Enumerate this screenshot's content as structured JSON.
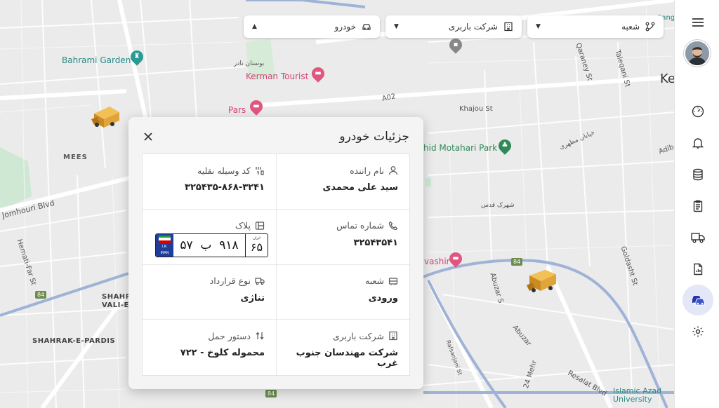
{
  "map": {
    "labels": {
      "bahrami_garden": "Bahrami Garden",
      "kerman_tourist": "Kerman Tourist",
      "pars": "Pars",
      "mees": "MEES",
      "jomhouri": "Jomhouri Blvd",
      "hemati": "Hemati-Far St",
      "shahr_vali": "SHAHR-E-\nVALI-E-",
      "shahrak_pardis": "SHAHRAK-E-PARDIS",
      "a02": "A02",
      "khajou": "Khajou St",
      "motahari_park": "hid Motahari Park",
      "qaraney": "Qaraney St",
      "taleqani": "Taleqani St",
      "kerman_top": "Ke",
      "adib": "Adib",
      "vashir": "vashir",
      "goldasht": "Goldasht St",
      "abuzar_s": "Abuzar S",
      "abuzar": "Abuzar",
      "resalat": "Resalat Blvd",
      "azad": "Islamic Azad\nUniversity",
      "24_mehr": "24 Mehr",
      "jangal": "Sang",
      "persian_park": "بوستان نادر",
      "persian_shahrak": "شهرک قدس",
      "persian_haji": "خیابان مطهری",
      "rafsanjani": "Rafsanjani St"
    },
    "route_badges": [
      "84",
      "84",
      "84"
    ]
  },
  "filters": {
    "branch": "شعبه",
    "carrier": "شرکت باربری",
    "vehicle": "خودرو"
  },
  "sidebar": {
    "items": [
      {
        "name": "menu-icon"
      },
      {
        "name": "dashboard-icon"
      },
      {
        "name": "bell-icon"
      },
      {
        "name": "database-icon"
      },
      {
        "name": "clipboard-icon"
      },
      {
        "name": "truck-icon"
      },
      {
        "name": "report-icon"
      },
      {
        "name": "cars-icon"
      },
      {
        "name": "settings-icon"
      }
    ],
    "active": "cars-icon"
  },
  "modal": {
    "title": "جزئیات خودرو",
    "fields": {
      "driver_label": "نام راننده",
      "driver_value": "سید علی محمدی",
      "vehicle_code_label": "کد وسیله نقلیه",
      "vehicle_code_value": "۳۲۵۴۳۵-۸۶۸-۳۲۴۱",
      "phone_label": "شماره تماس",
      "phone_value": "۳۲۵۴۳۵۴۱",
      "plate_label": "پلاک",
      "branch_label": "شعبه",
      "branch_value": "ورودی",
      "contract_label": "نوع قرارداد",
      "contract_value": "تناژی",
      "carrier_label": "شرکت باربری",
      "carrier_value": "شرکت مهندسان جنوب غرب",
      "order_label": "دستور حمل",
      "order_value": "محموله کلوخ - ۷۲۲"
    },
    "plate": {
      "country_top": "I.R.",
      "country_bottom": "IRAN",
      "part1": "۵۷",
      "letter": "ب",
      "part2": "۹۱۸",
      "region_label": "ایران",
      "region": "۶۵"
    }
  }
}
